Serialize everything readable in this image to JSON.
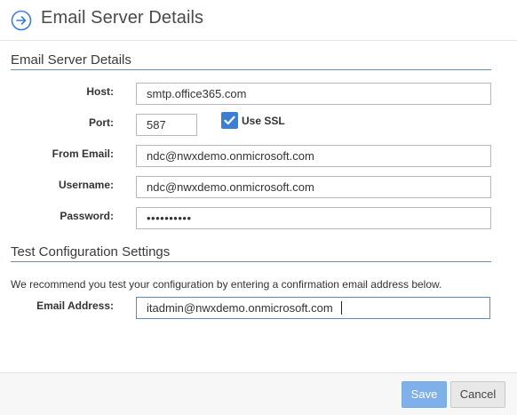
{
  "header": {
    "title": "Email Server Details"
  },
  "server_section": {
    "title": "Email Server Details",
    "host": {
      "label": "Host:",
      "value": "smtp.office365.com"
    },
    "port": {
      "label": "Port:",
      "value": "587"
    },
    "use_ssl": {
      "label": "Use SSL",
      "checked": true
    },
    "from_email": {
      "label": "From Email:",
      "value": "ndc@nwxdemo.onmicrosoft.com"
    },
    "username": {
      "label": "Username:",
      "value": "ndc@nwxdemo.onmicrosoft.com"
    },
    "password": {
      "label": "Password:",
      "value": "••••••••••"
    }
  },
  "test_section": {
    "title": "Test Configuration Settings",
    "info": "We recommend you test your configuration by entering a confirmation email address below.",
    "email": {
      "label": "Email Address:",
      "value": "itadmin@nwxdemo.onmicrosoft.com"
    }
  },
  "footer": {
    "save_label": "Save",
    "cancel_label": "Cancel"
  },
  "colors": {
    "accent": "#3a7fd5",
    "save_button": "#7fb0ea",
    "section_rule": "#6b8fb4"
  }
}
